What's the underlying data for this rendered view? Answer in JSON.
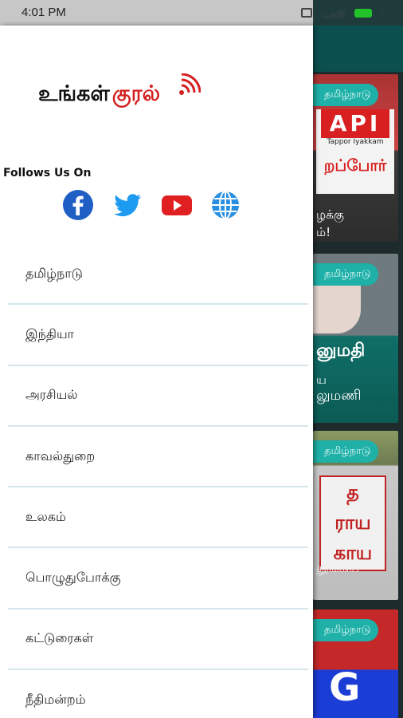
{
  "status_bar": {
    "time": "4:01 PM",
    "icons": [
      "notification-icon",
      "signal-icon",
      "battery-icon",
      "charging-icon"
    ],
    "battery_color": "#22c22a"
  },
  "drawer": {
    "logo": {
      "word1": "உங்கள்",
      "word2": "குரல்",
      "wifi_color": "#d42020"
    },
    "follow_label": "Follows Us On",
    "social": [
      {
        "name": "facebook-icon",
        "color": "#1f5fc4"
      },
      {
        "name": "twitter-icon",
        "color": "#1d9bf0"
      },
      {
        "name": "youtube-icon",
        "color": "#e02020"
      },
      {
        "name": "website-globe-icon",
        "color": "#2a8fe0"
      }
    ],
    "menu": [
      {
        "label": "தமிழ்நாடு"
      },
      {
        "label": "இந்தியா"
      },
      {
        "label": "அரசியல்"
      },
      {
        "label": "காவல்துறை"
      },
      {
        "label": "உலகம்"
      },
      {
        "label": "பொழுதுபோக்கு"
      },
      {
        "label": "கட்டுரைகள்"
      },
      {
        "label": "நீதிமன்றம்"
      }
    ],
    "divider_color": "#d6e6ec"
  },
  "background_feed": {
    "cards": [
      {
        "tag": "தமிழ்நாடு",
        "poster_title": "API",
        "poster_sub": "Tappor Iyakkam",
        "poster_tamil": "றப்போர்",
        "caption1": "ழக்கு",
        "caption2": "ம்!"
      },
      {
        "tag": "தமிழ்நாடு",
        "caption1": "னுமதி",
        "caption2": "ய",
        "caption3": "லுமணி"
      },
      {
        "tag": "தமிழ்நாடு",
        "sign1": "த",
        "sign2": "ராய",
        "sign3": "காய",
        "caption1": "தூங்கிய"
      },
      {
        "tag": "தமிழ்நாடு",
        "big": "G"
      }
    ],
    "accent_color": "#1fb0a8"
  }
}
